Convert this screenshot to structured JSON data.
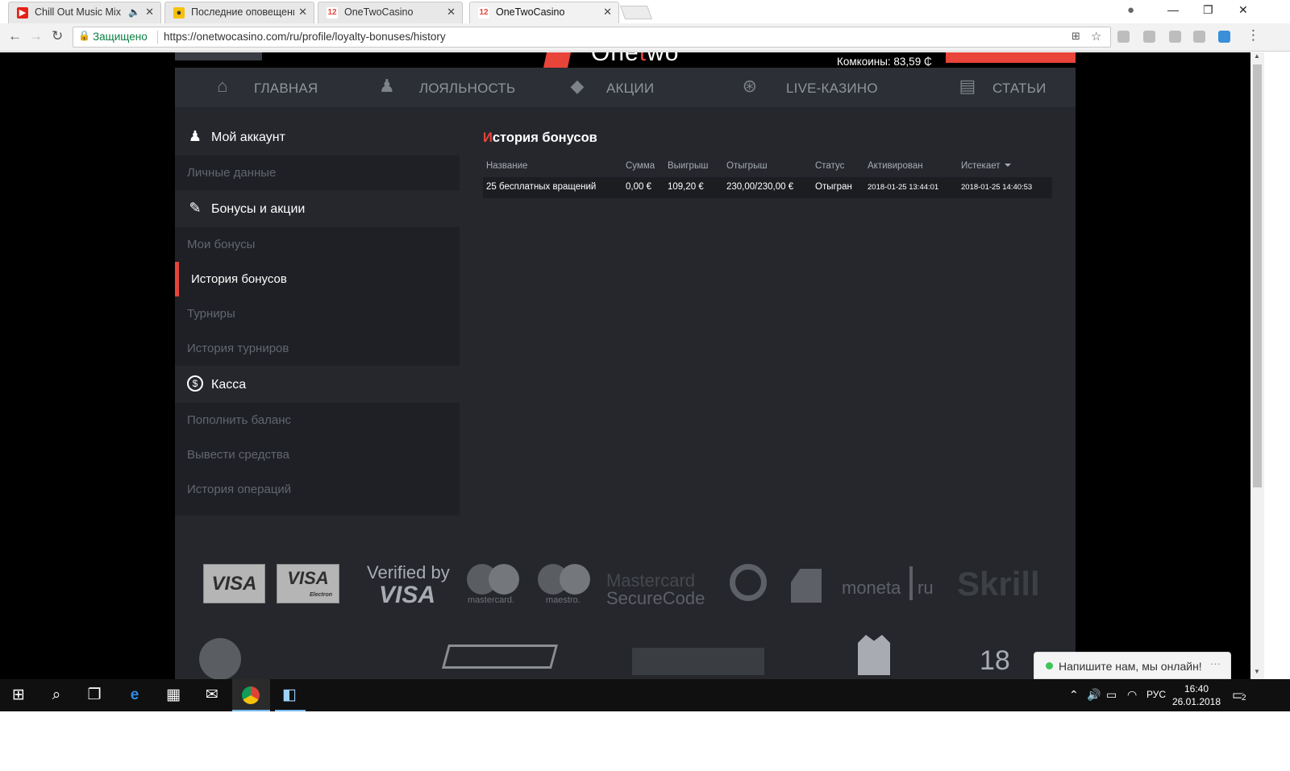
{
  "browser": {
    "tabs": [
      {
        "title": "Chill Out Music Mix",
        "favicon": "youtube-icon",
        "audio": true
      },
      {
        "title": "Последние оповещени",
        "favicon": "bell-icon"
      },
      {
        "title": "OneTwoCasino",
        "favicon": "onetwo-icon"
      },
      {
        "title": "OneTwoCasino",
        "favicon": "onetwo-icon",
        "active": true
      }
    ],
    "security_label": "Защищено",
    "url": "https://onetwocasino.com/ru/profile/loyalty-bonuses/history"
  },
  "header": {
    "comcoins_label": "Комкоины: 83,59 ₵"
  },
  "mainnav": [
    {
      "label": "Главная",
      "icon": "home-icon"
    },
    {
      "label": "Лояльность",
      "icon": "person-icon"
    },
    {
      "label": "Акции",
      "icon": "tag-icon"
    },
    {
      "label": "Live-казино",
      "icon": "roulette-icon"
    },
    {
      "label": "Статьи",
      "icon": "clipboard-icon"
    }
  ],
  "sidebar": {
    "account": {
      "label": "Мой аккаунт",
      "icon": "account-icon"
    },
    "personal": "Личные данные",
    "bonuses": {
      "label": "Бонусы и акции",
      "icon": "ticket-icon"
    },
    "my_bonuses": "Мои бонусы",
    "bonus_history": "История бонусов",
    "tournaments": "Турниры",
    "tournament_history": "История турниров",
    "cashier": {
      "label": "Касса",
      "icon": "dollar-icon"
    },
    "deposit": "Пополнить баланс",
    "withdraw": "Вывести средства",
    "transactions": "История операций"
  },
  "content": {
    "title_first": "И",
    "title_rest": "стория бонусов",
    "columns": [
      "Название",
      "Сумма",
      "Выигрыш",
      "Отыгрыш",
      "Статус",
      "Активирован",
      "Истекает"
    ],
    "rows": [
      [
        "25 бесплатных вращений",
        "0,00 €",
        "109,20 €",
        "230,00/230,00 €",
        "Отыгран",
        "2018-01-25 13:44:01",
        "2018-01-25 14:40:53"
      ]
    ]
  },
  "payments": {
    "visa": "VISA",
    "visa_electron": "VISA",
    "visa_electron_sub": "Electron",
    "verified_line1": "Verified by",
    "verified_line2": "VISA",
    "mastercard": "mastercard.",
    "maestro": "maestro.",
    "securecode_line1": "Mastercard",
    "securecode_line2": "SecureCode",
    "moneta": "moneta",
    "moneta_ru": "ru",
    "skrill": "Skrill",
    "age": "18"
  },
  "chat": {
    "label": "Напишите нам, мы онлайн!"
  },
  "taskbar": {
    "lang": "РУС",
    "time": "16:40",
    "date": "26.01.2018",
    "notifications": "2"
  }
}
